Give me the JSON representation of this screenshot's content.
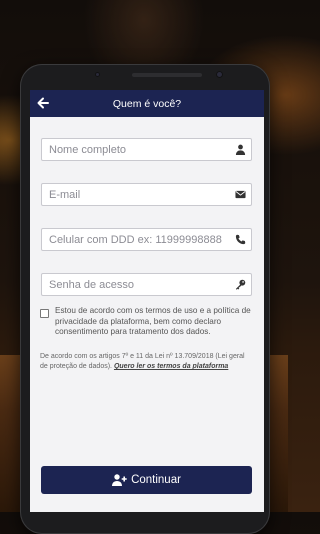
{
  "header": {
    "title": "Quem é você?",
    "back_icon": "arrow-left-icon"
  },
  "form": {
    "name": {
      "placeholder": "Nome completo",
      "icon": "user-icon"
    },
    "email": {
      "placeholder": "E-mail",
      "icon": "envelope-icon"
    },
    "phone": {
      "placeholder": "Celular com DDD ex: 11999998888",
      "icon": "phone-icon"
    },
    "password": {
      "placeholder": "Senha de acesso",
      "icon": "key-icon"
    }
  },
  "consent": {
    "checked": false,
    "text": "Estou de acordo com os termos de uso e a política de privacidade da plataforma, bem como declaro consentimento para tratamento dos dados."
  },
  "legal": {
    "text": "De acordo com os artigos 7º e 11 da Lei nº 13.709/2018 (Lei geral de proteção de dados).",
    "link": "Quero ler os termos da plataforma"
  },
  "actions": {
    "continue_label": "Continuar",
    "continue_icon": "user-plus-icon"
  },
  "colors": {
    "primary": "#1c2452",
    "screen_bg": "#f3f3f5"
  }
}
